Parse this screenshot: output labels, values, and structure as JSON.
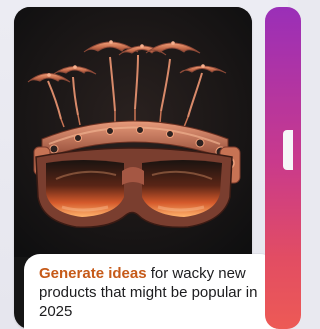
{
  "cards": [
    {
      "image_subject": "Sci-fi goggles with umbrellas",
      "caption": {
        "highlight": "Generate ideas",
        "rest": " for wacky new products that might be popular in 2025"
      }
    }
  ],
  "colors": {
    "highlight": "#c65a19",
    "caption_text": "#1d1d1f",
    "next_card_gradient": [
      "#9a2fb8",
      "#c93a8c",
      "#ed5a55"
    ]
  }
}
